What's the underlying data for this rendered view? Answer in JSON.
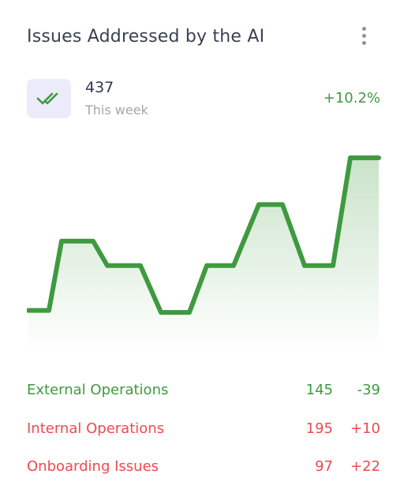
{
  "card": {
    "title": "Issues Addressed by the AI",
    "menu_icon": "more-vertical-icon"
  },
  "summary": {
    "icon": "double-check-icon",
    "value": "437",
    "label": "This week",
    "change": "+10.2%"
  },
  "colors": {
    "accent_green": "#3f9a3f",
    "negative_red": "#ef4a50",
    "icon_bg": "#ebebfa"
  },
  "chart_data": {
    "type": "area",
    "title": "",
    "xlabel": "",
    "ylabel": "",
    "grid": false,
    "legend": "none",
    "ylim": [
      0,
      100
    ],
    "series": [
      {
        "values": [
          18,
          18,
          52,
          52,
          40,
          40,
          17,
          17,
          40,
          40,
          70,
          70,
          40,
          40,
          93,
          93
        ]
      }
    ]
  },
  "breakdown": [
    {
      "name": "External Operations",
      "count": "145",
      "delta": "-39",
      "tone": "green"
    },
    {
      "name": "Internal Operations",
      "count": "195",
      "delta": "+10",
      "tone": "red"
    },
    {
      "name": "Onboarding Issues",
      "count": "97",
      "delta": "+22",
      "tone": "red"
    }
  ]
}
